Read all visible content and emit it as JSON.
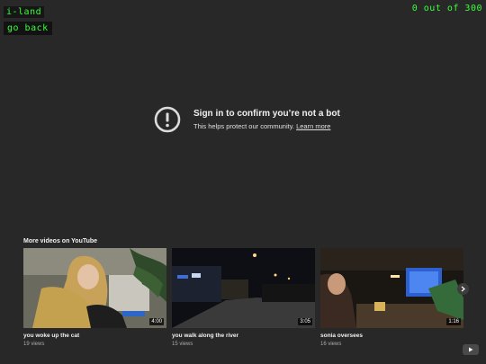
{
  "app": {
    "title": "i-land",
    "back_label": "go back",
    "counter": "0 out of 300"
  },
  "notice": {
    "title": "Sign in to confirm you’re not a bot",
    "message": "This helps protect our community.",
    "link": "Learn more",
    "icon": "alert-circle-icon"
  },
  "more_videos": {
    "label": "More videos on YouTube",
    "videos": [
      {
        "title": "you woke up the cat",
        "views": "19 views",
        "duration": "4:00"
      },
      {
        "title": "you walk along the river",
        "views": "15 views",
        "duration": "3:05"
      },
      {
        "title": "sonia oversees",
        "views": "16 views",
        "duration": "1:16"
      }
    ]
  },
  "icons": {
    "next": "chevron-right-icon",
    "logo": "youtube-logo-icon"
  },
  "colors": {
    "accent": "#39ff39",
    "background": "#282828"
  }
}
